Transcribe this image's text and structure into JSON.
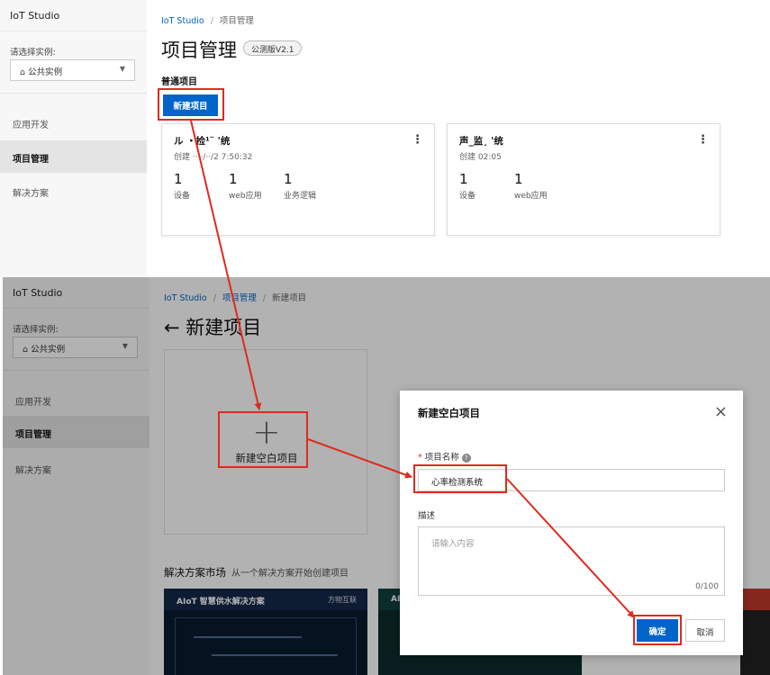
{
  "app_title": "IoT Studio",
  "sidebar": {
    "instance_label": "请选择实例:",
    "instance_value": "公共实例",
    "instance_icon": "building-icon",
    "items": [
      {
        "label": "应用开发"
      },
      {
        "label": "项目管理",
        "active": true
      },
      {
        "label": "解决方案"
      }
    ]
  },
  "top": {
    "breadcrumb": [
      "IoT Studio",
      "项目管理"
    ],
    "page_title": "项目管理",
    "version_badge": "公测版V2.1",
    "section_title": "普通项目",
    "new_project_button": "新建项目",
    "cards": [
      {
        "name": "ル  ・捡¹¨  '统",
        "subtitle": "创建    ····/··/2  7:50:32",
        "stats": [
          {
            "value": "1",
            "label": "设备"
          },
          {
            "value": "1",
            "label": "web应用"
          },
          {
            "value": "1",
            "label": "业务逻辑"
          }
        ]
      },
      {
        "name": "声_监¸  '统",
        "subtitle": "创建                   02:05",
        "stats": [
          {
            "value": "1",
            "label": "设备"
          },
          {
            "value": "1",
            "label": "web应用"
          }
        ]
      }
    ]
  },
  "bottom": {
    "breadcrumb": [
      "IoT Studio",
      "项目管理",
      "新建项目"
    ],
    "back_arrow": "←",
    "page_title": "新建项目",
    "blank_project_plus": "+",
    "blank_project_label": "新建空白项目",
    "market_title": "解决方案市场",
    "market_subtitle": "从一个解决方案开始创建项目",
    "thumbnails": [
      {
        "title": "AIoT 智慧供水解决方案",
        "brand": "方物互联"
      },
      {
        "title": "AI",
        "brand": ""
      }
    ]
  },
  "modal": {
    "title": "新建空白项目",
    "close_symbol": "×",
    "name_label": "项目名称",
    "required_mark": "*",
    "help_symbol": "?",
    "name_value": "心率检测系统",
    "desc_label": "描述",
    "desc_placeholder": "请输入内容",
    "desc_counter": "0/100",
    "confirm_button": "确定",
    "cancel_button": "取消"
  },
  "colors": {
    "primary": "#0064c8",
    "highlight": "#e02a1e",
    "sidebar_bg": "#f7f7f7"
  }
}
